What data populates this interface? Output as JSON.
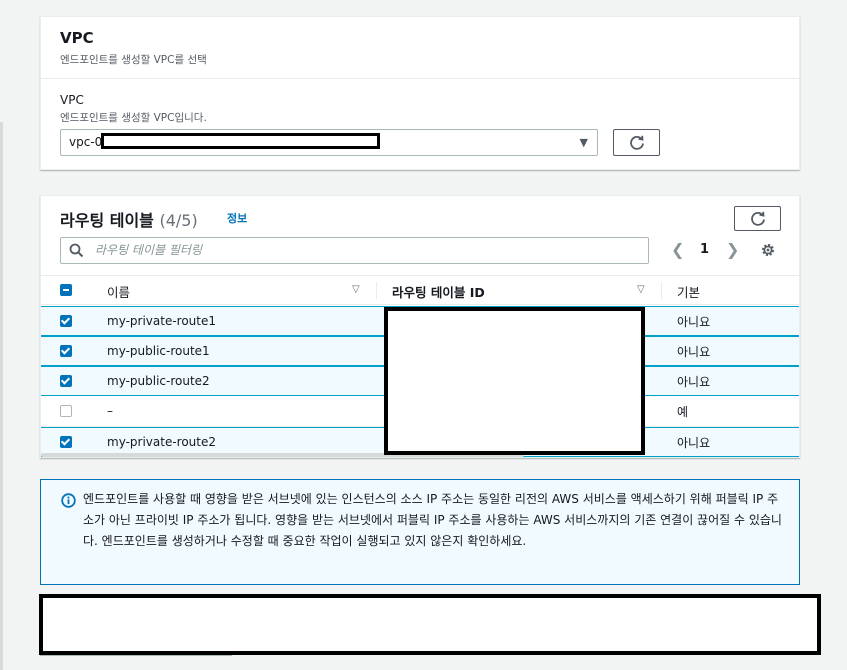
{
  "vpc": {
    "title": "VPC",
    "description": "엔드포인트를 생성할 VPC를 선택",
    "field_label": "VPC",
    "field_description": "엔드포인트를 생성할 VPC입니다.",
    "selected_value": "vpc-0"
  },
  "route_tables": {
    "title": "라우팅 테이블",
    "count": "(4/5)",
    "info_link": "정보",
    "search_placeholder": "라우팅 테이블 필터링",
    "pagination": {
      "current_page": "1"
    },
    "columns": {
      "name": "이름",
      "id": "라우팅 테이블 ID",
      "default": "기본"
    },
    "rows": [
      {
        "name": "my-private-route1",
        "default": "아니요",
        "selected": true
      },
      {
        "name": "my-public-route1",
        "default": "아니요",
        "selected": true
      },
      {
        "name": "my-public-route2",
        "default": "아니요",
        "selected": true
      },
      {
        "name": "–",
        "default": "예",
        "selected": false
      },
      {
        "name": "my-private-route2",
        "default": "아니요",
        "selected": true
      }
    ]
  },
  "alert": {
    "text": "엔드포인트를 사용할 때 영향을 받은 서브넷에 있는 인스턴스의 소스 IP 주소는 동일한 리전의 AWS 서비스를 액세스하기 위해 퍼블릭 IP 주소가 아닌 프라이빗 IP 주소가 됩니다. 영향을 받는 서브넷에서 퍼블릭 IP 주소를 사용하는 AWS 서비스까지의 기존 연결이 끊어질 수 있습니다. 엔드포인트를 생성하거나 수정할 때 중요한 작업이 실행되고 있지 않은지 확인하세요."
  },
  "colors": {
    "accent": "#0073bb",
    "selected_row_bg": "#f1faff",
    "selected_row_border": "#00a1c9"
  }
}
